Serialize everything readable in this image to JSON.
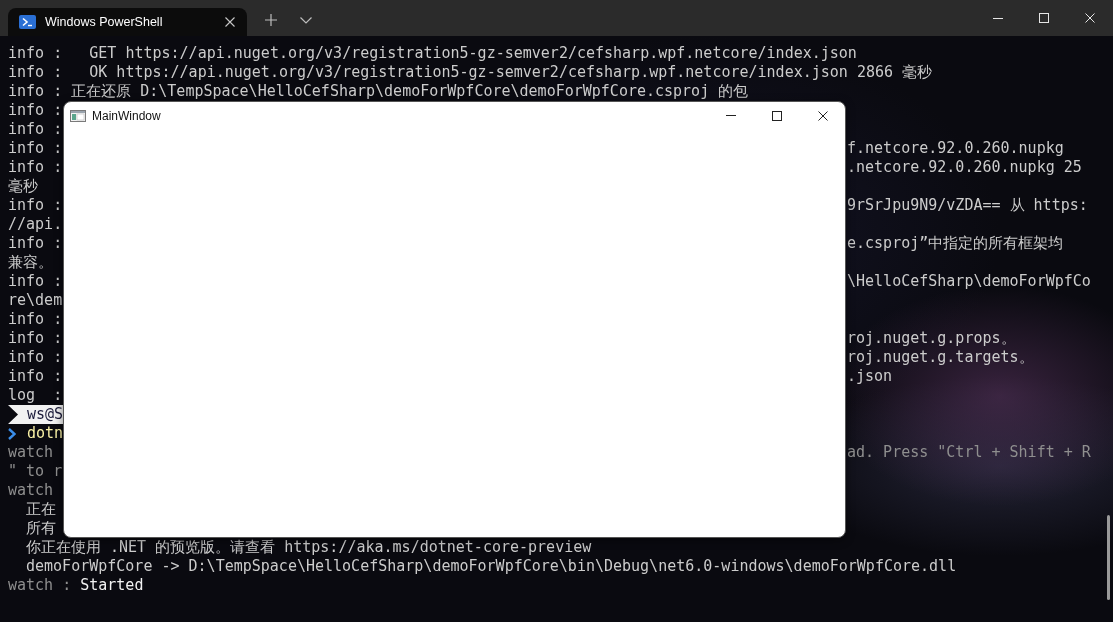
{
  "tabs": [
    {
      "title": "Windows PowerShell",
      "selected": true
    }
  ],
  "terminal": {
    "lines": [
      {
        "kind": "plain",
        "text": "info :   GET https://api.nuget.org/v3/registration5-gz-semver2/cefsharp.wpf.netcore/index.json"
      },
      {
        "kind": "plain",
        "text": "info :   OK https://api.nuget.org/v3/registration5-gz-semver2/cefsharp.wpf.netcore/index.json 2866 毫秒"
      },
      {
        "kind": "plain",
        "text": "info : 正在还原 D:\\TempSpace\\HelloCefSharp\\demoForWpfCore\\demoForWpfCore.csproj 的包"
      },
      {
        "kind": "plain",
        "text": "info :"
      },
      {
        "kind": "plain",
        "text": "info :"
      },
      {
        "kind": "plain",
        "text": "info :",
        "tail": "f.netcore.92.0.260.nupkg"
      },
      {
        "kind": "plain",
        "text": "info :",
        "tail": ".netcore.92.0.260.nupkg 25"
      },
      {
        "kind": "plain",
        "text": "毫秒"
      },
      {
        "kind": "plain",
        "text": "info :",
        "tail": "9rSrJpu9N9/vZDA== 从 https:"
      },
      {
        "kind": "plain",
        "text": "//api."
      },
      {
        "kind": "plain",
        "text": "info :",
        "tail": "e.csproj”中指定的所有框架均"
      },
      {
        "kind": "plain",
        "text": "兼容。"
      },
      {
        "kind": "plain",
        "text": "info :",
        "tail": "\\HelloCefSharp\\demoForWpfCo"
      },
      {
        "kind": "plain",
        "text": "re\\dem"
      },
      {
        "kind": "plain",
        "text": "info :"
      },
      {
        "kind": "plain",
        "text": "info :",
        "tail": "roj.nuget.g.props。"
      },
      {
        "kind": "plain",
        "text": "info :",
        "tail": "roj.nuget.g.targets。"
      },
      {
        "kind": "plain",
        "text": "info :",
        "tail": ".json"
      },
      {
        "kind": "plain",
        "text": "log  :"
      },
      {
        "kind": "prompt",
        "text": "ws@S"
      },
      {
        "kind": "command",
        "text": "dotn"
      },
      {
        "kind": "dim",
        "text": "watch",
        "tail": "ad. Press \"Ctrl + Shift + R"
      },
      {
        "kind": "dim",
        "text": "\" to r"
      },
      {
        "kind": "dim",
        "text": "watch"
      },
      {
        "kind": "indented",
        "text": "正在"
      },
      {
        "kind": "indented",
        "text": "所有"
      },
      {
        "kind": "indented",
        "text": "你正在使用 .NET 的预览版。请查看 https://aka.ms/dotnet-core-preview"
      },
      {
        "kind": "indented",
        "text": "demoForWpfCore -> D:\\TempSpace\\HelloCefSharp\\demoForWpfCore\\bin\\Debug\\net6.0-windows\\demoForWpfCore.dll"
      },
      {
        "kind": "status",
        "label": "watch :",
        "text": "Started"
      }
    ]
  },
  "dialog": {
    "title": "MainWindow"
  }
}
